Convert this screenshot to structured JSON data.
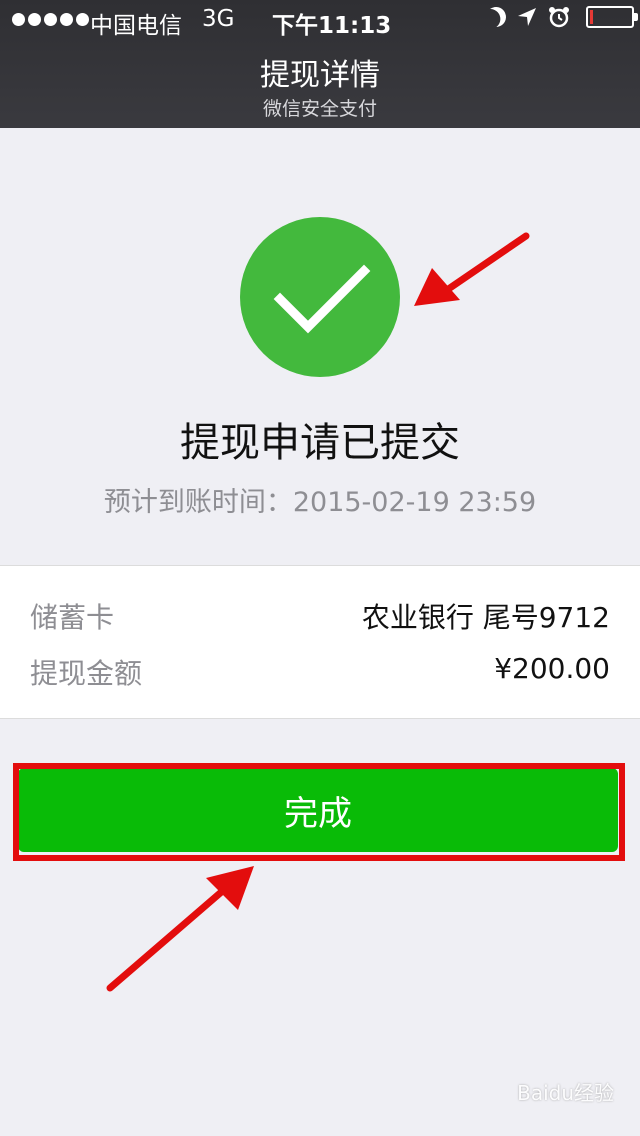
{
  "status_bar": {
    "carrier": "中国电信",
    "network": "3G",
    "time": "下午11:13"
  },
  "nav": {
    "title": "提现详情",
    "subtitle": "微信安全支付"
  },
  "result": {
    "title": "提现申请已提交",
    "eta": "预计到账时间：2015-02-19 23:59"
  },
  "details": [
    {
      "label": "储蓄卡",
      "value": "农业银行 尾号9712"
    },
    {
      "label": "提现金额",
      "value": "¥200.00"
    }
  ],
  "actions": {
    "done_label": "完成"
  },
  "watermark": {
    "text": "Baidu经验"
  },
  "colors": {
    "success_green": "#43b93d",
    "button_green": "#09bb07",
    "annotation_red": "#e30d0d"
  },
  "icons": [
    "moon-icon",
    "location-arrow-icon",
    "alarm-icon",
    "battery-icon",
    "checkmark-icon"
  ]
}
